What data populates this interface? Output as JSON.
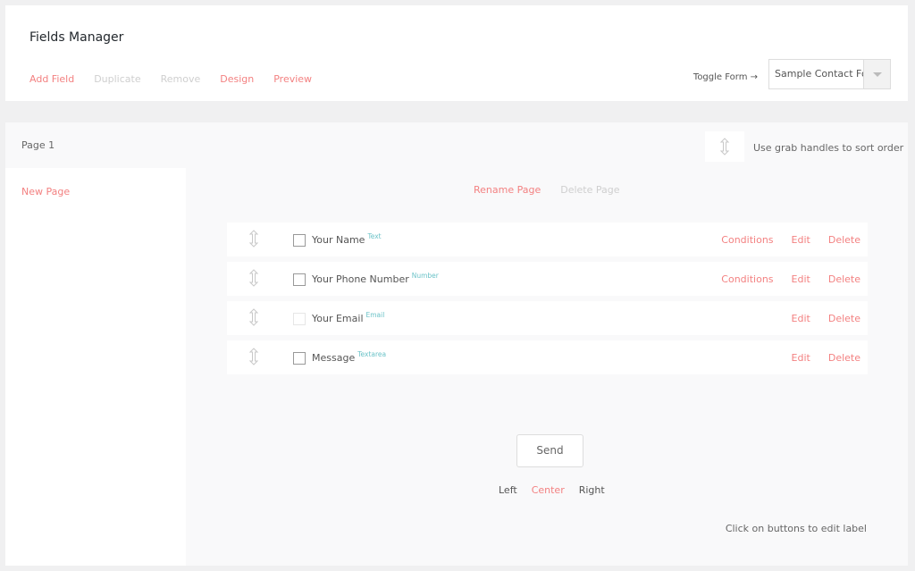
{
  "header": {
    "title": "Fields Manager",
    "toolbar": [
      {
        "label": "Add Field",
        "enabled": true
      },
      {
        "label": "Duplicate",
        "enabled": false
      },
      {
        "label": "Remove",
        "enabled": false
      },
      {
        "label": "Design",
        "enabled": true
      },
      {
        "label": "Preview",
        "enabled": true
      }
    ],
    "toggle_label": "Toggle Form →",
    "form_select": {
      "value": "Sample Contact Form"
    }
  },
  "pages": {
    "current": "Page 1",
    "new_page_label": "New Page",
    "rename_label": "Rename Page",
    "delete_label": "Delete Page"
  },
  "hint": {
    "icon": "grab-handle-icon",
    "text": "Use grab handles to sort order"
  },
  "fields": [
    {
      "label": "Your Name",
      "type": "Text",
      "actions": [
        "Conditions",
        "Edit",
        "Delete"
      ]
    },
    {
      "label": "Your Phone Number",
      "type": "Number",
      "actions": [
        "Conditions",
        "Edit",
        "Delete"
      ]
    },
    {
      "label": "Your Email",
      "type": "Email",
      "actions": [
        "Edit",
        "Delete"
      ]
    },
    {
      "label": "Message",
      "type": "Textarea",
      "actions": [
        "Edit",
        "Delete"
      ]
    }
  ],
  "submit": {
    "label": "Send",
    "alignments": [
      "Left",
      "Center",
      "Right"
    ],
    "selected_alignment": "Center",
    "hint": "Click on buttons to edit label"
  },
  "colors": {
    "accent": "#f38181",
    "type_tag": "#6cc3c8",
    "disabled": "#cfcfcf"
  }
}
